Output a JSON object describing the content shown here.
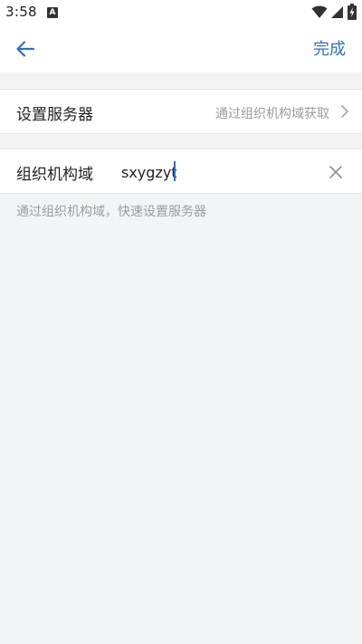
{
  "status_bar": {
    "time": "3:58",
    "notification_badge": "A",
    "icons": [
      "wifi-icon",
      "cell-signal-icon",
      "battery-charging-icon"
    ]
  },
  "app_bar": {
    "back_icon": "arrow-left-icon",
    "done_label": "完成",
    "accent_color": "#2f6fc6"
  },
  "server_row": {
    "label": "设置服务器",
    "value": "通过组织机构域获取",
    "chevron_icon": "chevron-right-icon"
  },
  "domain_row": {
    "label": "组织机构域",
    "input_value": "sxygzyt",
    "clear_icon": "close-icon"
  },
  "hint": "通过组织机构域，快速设置服务器"
}
